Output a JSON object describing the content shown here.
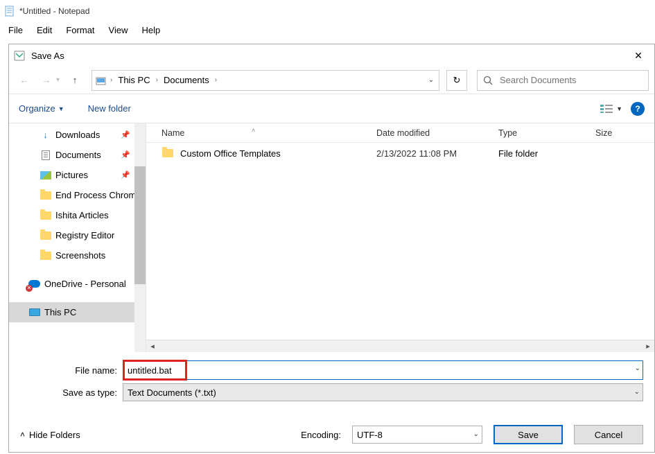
{
  "notepad": {
    "title": "*Untitled - Notepad",
    "menu": {
      "file": "File",
      "edit": "Edit",
      "format": "Format",
      "view": "View",
      "help": "Help"
    }
  },
  "dialog": {
    "title": "Save As",
    "breadcrumb": {
      "root": "This PC",
      "folder": "Documents"
    },
    "search_placeholder": "Search Documents",
    "organize_label": "Organize",
    "newfolder_label": "New folder",
    "columns": {
      "name": "Name",
      "date": "Date modified",
      "type": "Type",
      "size": "Size"
    },
    "tree": {
      "downloads": "Downloads",
      "documents": "Documents",
      "pictures": "Pictures",
      "endprocess": "End Process Chrom",
      "ishita": "Ishita Articles",
      "registry": "Registry Editor",
      "screenshots": "Screenshots",
      "onedrive": "OneDrive - Personal",
      "thispc": "This PC"
    },
    "rows": [
      {
        "name": "Custom Office Templates",
        "date": "2/13/2022 11:08 PM",
        "type": "File folder"
      }
    ],
    "form": {
      "filename_label": "File name:",
      "filename_value": "untitled.bat",
      "saveastype_label": "Save as type:",
      "saveastype_value": "Text Documents (*.txt)",
      "encoding_label": "Encoding:",
      "encoding_value": "UTF-8",
      "hidefolders_label": "Hide Folders",
      "save_label": "Save",
      "cancel_label": "Cancel"
    }
  }
}
